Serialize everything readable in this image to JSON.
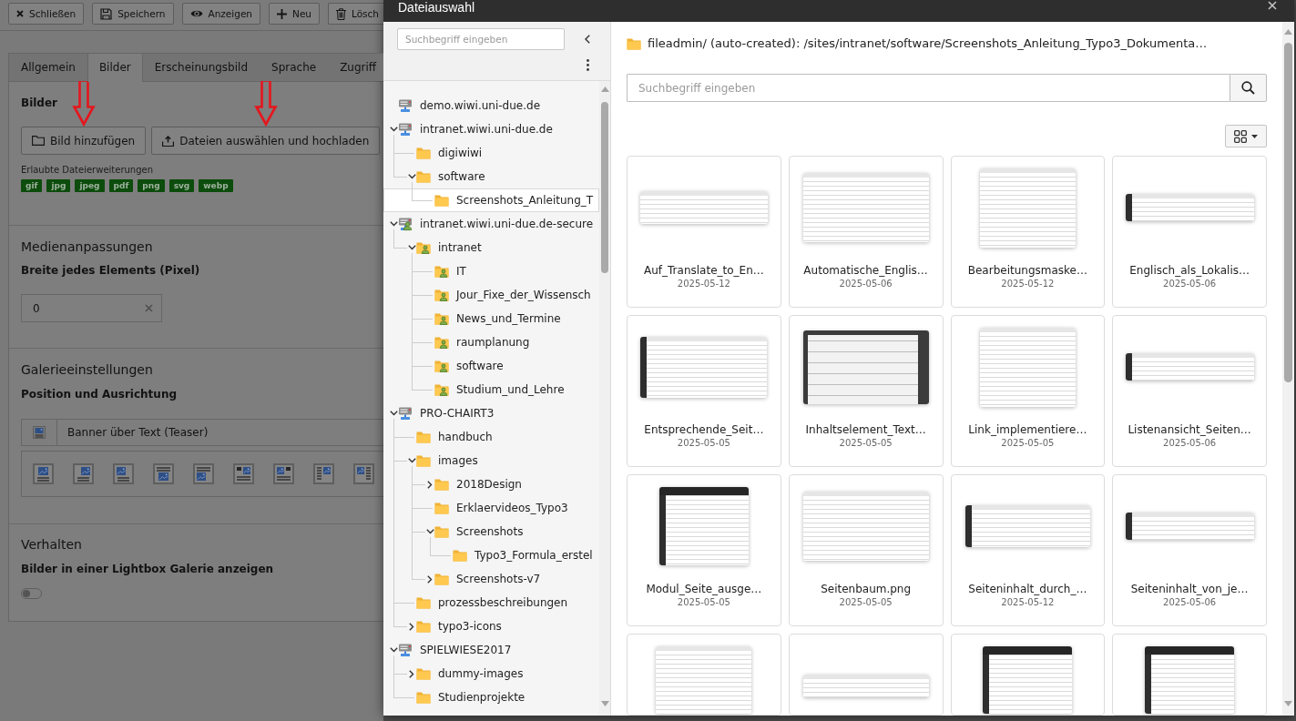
{
  "toolbar": {
    "buttons": [
      {
        "label": "Schließen",
        "kind": "close"
      },
      {
        "label": "Speichern",
        "kind": "save"
      },
      {
        "label": "Anzeigen",
        "kind": "view"
      },
      {
        "label": "Neu",
        "kind": "new"
      },
      {
        "label": "Lösch",
        "kind": "delete"
      }
    ]
  },
  "tabs": [
    {
      "label": "Allgemein",
      "selected": false
    },
    {
      "label": "Bilder",
      "selected": true
    },
    {
      "label": "Erscheinungsbild",
      "selected": false
    },
    {
      "label": "Sprache",
      "selected": false
    },
    {
      "label": "Zugriff",
      "selected": false
    }
  ],
  "images": {
    "heading": "Bilder",
    "buttons": [
      {
        "label": "Bild hinzufügen",
        "kind": "add",
        "annotated": true
      },
      {
        "label": "Dateien auswählen und hochladen",
        "kind": "upload",
        "annotated": true
      }
    ],
    "extensions_label": "Erlaubte Dateierweiterungen",
    "extensions": [
      "gif",
      "jpg",
      "jpeg",
      "pdf",
      "png",
      "svg",
      "webp"
    ]
  },
  "media": {
    "heading": "Medienanpassungen",
    "label": "Breite jedes Elements (Pixel)",
    "value": "0"
  },
  "gallery": {
    "heading": "Galerieeinstellungen",
    "label": "Position und Ausrichtung",
    "value": "Banner über Text (Teaser)"
  },
  "behavior": {
    "heading": "Verhalten",
    "label": "Bilder in einer Lightbox Galerie anzeigen",
    "on": false
  },
  "dialog": {
    "title": "Dateiauswahl",
    "tree_search": {
      "placeholder": "Suchbegriff eingeben"
    },
    "tree": [
      {
        "label": "demo.wiwi.uni-due.de",
        "kind": "server",
        "selected": false
      },
      {
        "label": "intranet.wiwi.uni-due.de",
        "kind": "server",
        "expanded": true,
        "selected": false,
        "children": [
          {
            "label": "digiwiwi",
            "kind": "folder",
            "selected": false
          },
          {
            "label": "software",
            "kind": "folder",
            "expanded": true,
            "selected": false,
            "children": [
              {
                "label": "Screenshots_Anleitung_T",
                "kind": "folder",
                "selected": true
              }
            ]
          }
        ]
      },
      {
        "label": "intranet.wiwi.uni-due.de-secure",
        "kind": "restricted-server",
        "expanded": true,
        "selected": false,
        "children": [
          {
            "label": "intranet",
            "kind": "restricted-folder",
            "expanded": true,
            "selected": false,
            "children": [
              {
                "label": "IT",
                "kind": "restricted-folder",
                "selected": false
              },
              {
                "label": "Jour_Fixe_der_Wissensch",
                "kind": "restricted-folder",
                "selected": false
              },
              {
                "label": "News_und_Termine",
                "kind": "restricted-folder",
                "selected": false
              },
              {
                "label": "raumplanung",
                "kind": "restricted-folder",
                "selected": false
              },
              {
                "label": "software",
                "kind": "restricted-folder",
                "selected": false
              },
              {
                "label": "Studium_und_Lehre",
                "kind": "restricted-folder",
                "selected": false
              }
            ]
          }
        ]
      },
      {
        "label": "PRO-CHAIRT3",
        "kind": "server",
        "expanded": true,
        "selected": false,
        "children": [
          {
            "label": "handbuch",
            "kind": "folder",
            "selected": false
          },
          {
            "label": "images",
            "kind": "folder",
            "expanded": true,
            "selected": false,
            "children": [
              {
                "label": "2018Design",
                "kind": "folder",
                "expanded": false,
                "selected": false
              },
              {
                "label": "Erklaervideos_Typo3",
                "kind": "folder",
                "selected": false
              },
              {
                "label": "Screenshots",
                "kind": "folder",
                "expanded": true,
                "selected": false,
                "children": [
                  {
                    "label": "Typo3_Formula_erstel",
                    "kind": "folder",
                    "selected": false
                  }
                ]
              },
              {
                "label": "Screenshots-v7",
                "kind": "folder",
                "expanded": false,
                "selected": false
              }
            ]
          },
          {
            "label": "prozessbeschreibungen",
            "kind": "folder",
            "selected": false
          },
          {
            "label": "typo3-icons",
            "kind": "folder",
            "expanded": false,
            "selected": false
          }
        ]
      },
      {
        "label": "SPIELWIESE2017",
        "kind": "server",
        "expanded": true,
        "selected": false,
        "children": [
          {
            "label": "dummy-images",
            "kind": "folder",
            "expanded": false,
            "selected": false
          },
          {
            "label": "Studienprojekte",
            "kind": "folder",
            "selected": false
          }
        ]
      }
    ],
    "path": "fileadmin/ (auto-created): /sites/intranet/software/Screenshots_Anleitung_Typo3_Dokumenta…",
    "search": {
      "placeholder": "Suchbegriff eingeben"
    },
    "files": [
      {
        "name": "Auf_Translate_to_En…",
        "date": "2025-05-12",
        "kind": "banner"
      },
      {
        "name": "Automatische_Englis…",
        "date": "2025-05-06",
        "kind": "landscape"
      },
      {
        "name": "Bearbeitungsmaske…",
        "date": "2025-05-12",
        "kind": "portrait"
      },
      {
        "name": "Englisch_als_Lokalis…",
        "date": "2025-05-06",
        "kind": "strip"
      },
      {
        "name": "Entsprechende_Seit…",
        "date": "2025-05-05",
        "kind": "sidebar"
      },
      {
        "name": "Inhaltselement_Text…",
        "date": "2025-05-05",
        "kind": "dark"
      },
      {
        "name": "Link_implementiere…",
        "date": "2025-05-05",
        "kind": "portrait"
      },
      {
        "name": "Listenansicht_Seiten…",
        "date": "2025-05-06",
        "kind": "strip"
      },
      {
        "name": "Modul_Seite_ausge…",
        "date": "2025-05-05",
        "kind": "dark-portrait"
      },
      {
        "name": "Seitenbaum.png",
        "date": "2025-05-05",
        "kind": "landscape"
      },
      {
        "name": "Seiteninhalt_durch_…",
        "date": "2025-05-12",
        "kind": "wide"
      },
      {
        "name": "Seiteninhalt_von_je…",
        "date": "2025-05-06",
        "kind": "strip"
      },
      {
        "kind": "portrait"
      },
      {
        "kind": "plain-strip"
      },
      {
        "kind": "dark-portrait"
      },
      {
        "kind": "dark-portrait"
      }
    ]
  }
}
